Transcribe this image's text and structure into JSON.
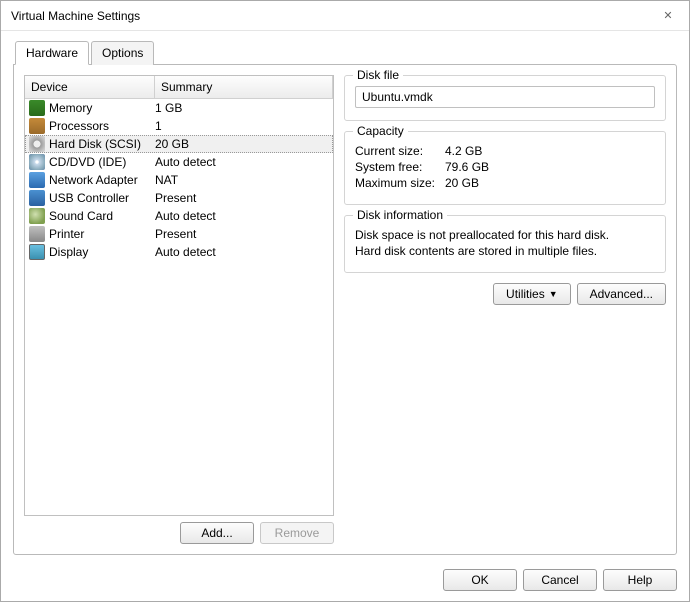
{
  "window": {
    "title": "Virtual Machine Settings",
    "close_glyph": "✕"
  },
  "tabs": {
    "hardware": "Hardware",
    "options": "Options"
  },
  "columns": {
    "device": "Device",
    "summary": "Summary"
  },
  "devices": [
    {
      "icon": "ic-mem",
      "name": "Memory",
      "summary": "1 GB"
    },
    {
      "icon": "ic-cpu",
      "name": "Processors",
      "summary": "1"
    },
    {
      "icon": "ic-hdd",
      "name": "Hard Disk (SCSI)",
      "summary": "20 GB",
      "selected": true
    },
    {
      "icon": "ic-cd",
      "name": "CD/DVD (IDE)",
      "summary": "Auto detect"
    },
    {
      "icon": "ic-net",
      "name": "Network Adapter",
      "summary": "NAT"
    },
    {
      "icon": "ic-usb",
      "name": "USB Controller",
      "summary": "Present"
    },
    {
      "icon": "ic-snd",
      "name": "Sound Card",
      "summary": "Auto detect"
    },
    {
      "icon": "ic-prn",
      "name": "Printer",
      "summary": "Present"
    },
    {
      "icon": "ic-dsp",
      "name": "Display",
      "summary": "Auto detect"
    }
  ],
  "left_buttons": {
    "add": "Add...",
    "remove": "Remove"
  },
  "disk_file": {
    "legend": "Disk file",
    "value": "Ubuntu.vmdk"
  },
  "capacity": {
    "legend": "Capacity",
    "current_size_label": "Current size:",
    "current_size_value": "4.2 GB",
    "system_free_label": "System free:",
    "system_free_value": "79.6 GB",
    "maximum_size_label": "Maximum size:",
    "maximum_size_value": "20 GB"
  },
  "disk_info": {
    "legend": "Disk information",
    "line1": "Disk space is not preallocated for this hard disk.",
    "line2": "Hard disk contents are stored in multiple files."
  },
  "right_buttons": {
    "utilities": "Utilities",
    "advanced": "Advanced..."
  },
  "footer": {
    "ok": "OK",
    "cancel": "Cancel",
    "help": "Help"
  }
}
